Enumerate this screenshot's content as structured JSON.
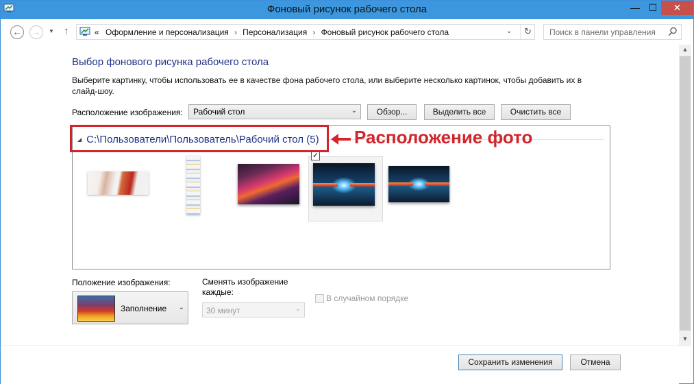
{
  "window": {
    "title": "Фоновый рисунок рабочего стола",
    "minimize": "—",
    "maximize": "☐",
    "close": "✕"
  },
  "nav": {
    "back": "←",
    "forward": "→",
    "up": "↑",
    "breadcrumb": [
      "Оформление и персонализация",
      "Персонализация",
      "Фоновый рисунок рабочего стола"
    ],
    "breadcrumb_lead": "«",
    "separator": "›",
    "search_placeholder": "Поиск в панели управления"
  },
  "content": {
    "heading": "Выбор фонового рисунка рабочего стола",
    "description": "Выберите картинку, чтобы использовать ее в качестве фона рабочего стола, или выберите несколько картинок, чтобы добавить их в слайд-шоу.",
    "location_label": "Расположение изображения:",
    "location_value": "Рабочий стол",
    "browse_button": "Обзор...",
    "select_all_button": "Выделить все",
    "clear_all_button": "Очистить все",
    "folder_path": "C:\\Пользователи\\Пользователь\\Рабочий стол (5)",
    "annotation": "Расположение фото",
    "selected_check": "✓",
    "position_label": "Положение изображения:",
    "position_value": "Заполнение",
    "change_label": "Сменять изображение каждые:",
    "change_value": "30 минут",
    "shuffle_label": "В случайном порядке",
    "save_button": "Сохранить изменения",
    "cancel_button": "Отмена"
  },
  "colors": {
    "titlebar": "#3c97df",
    "heading": "#1e3287",
    "annotation": "#d2252b",
    "close_button": "#c7504b"
  }
}
